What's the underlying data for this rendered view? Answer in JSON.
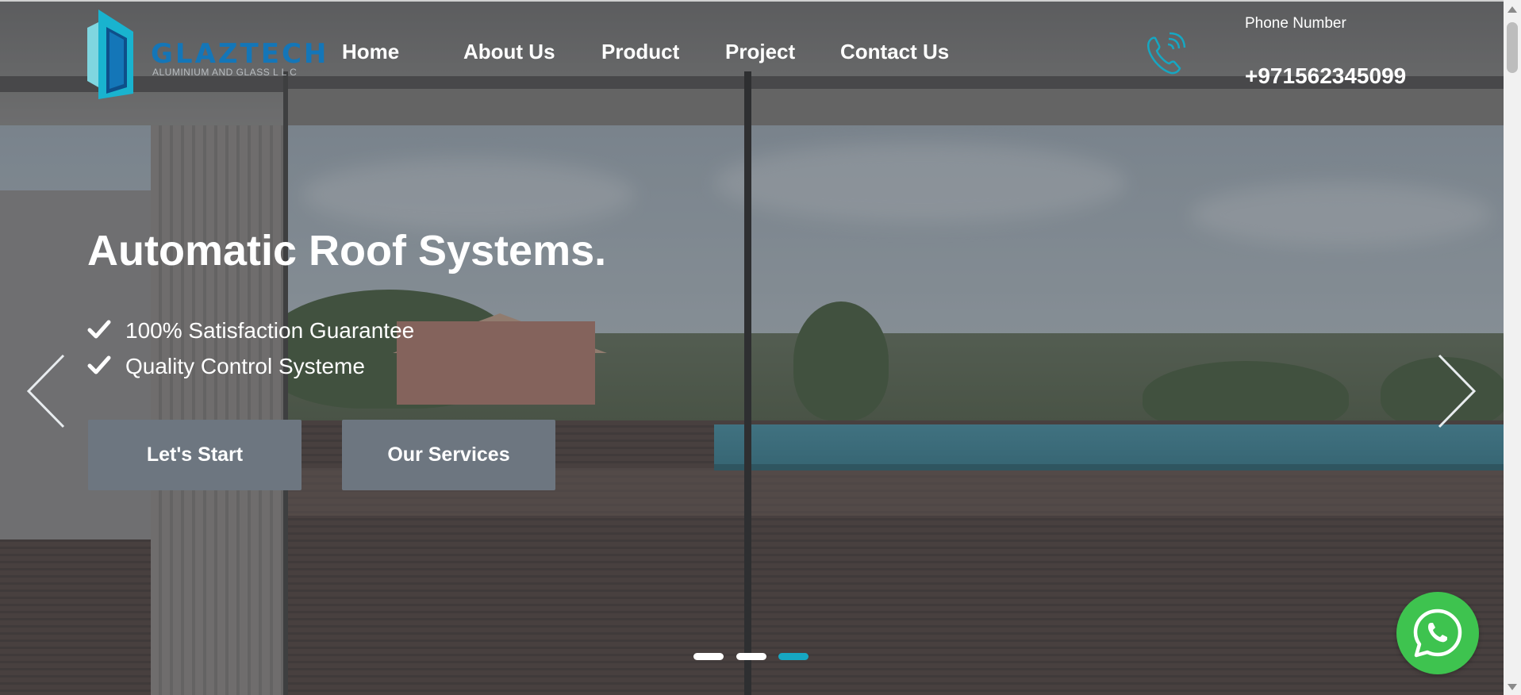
{
  "brand": {
    "name": "GLAZTECH",
    "tagline": "ALUMINIUM AND GLASS L L C",
    "colors": {
      "primary": "#1476b8",
      "accent": "#16a7c2",
      "button": "#6d7680",
      "whatsapp": "#3ec34f"
    }
  },
  "nav": {
    "items": [
      {
        "label": "Home"
      },
      {
        "label": "About Us"
      },
      {
        "label": "Product"
      },
      {
        "label": "Project"
      },
      {
        "label": "Contact Us"
      }
    ]
  },
  "contact": {
    "icon": "phone-icon",
    "label": "Phone Number",
    "number": "+971562345099"
  },
  "hero": {
    "title": "Automatic Roof Systems.",
    "features": [
      {
        "icon": "check-icon",
        "text": "100% Satisfaction Guarantee"
      },
      {
        "icon": "check-icon",
        "text": "Quality Control Systeme"
      }
    ],
    "buttons": {
      "start": "Let's Start",
      "services": "Our Services"
    }
  },
  "carousel": {
    "slide_count": 3,
    "active_index": 2,
    "prev_icon": "chevron-left-icon",
    "next_icon": "chevron-right-icon"
  },
  "widgets": {
    "whatsapp_icon": "whatsapp-icon"
  }
}
